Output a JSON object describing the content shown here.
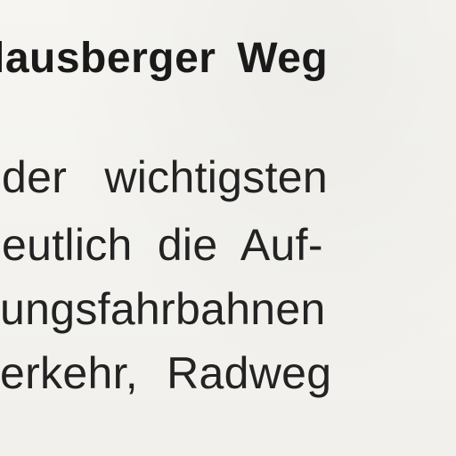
{
  "heading": "lausberger Weg",
  "lines": [
    "der wichtigsten",
    "eutlich die Auf-",
    "ungsfahrbahnen",
    "erkehr, Radweg"
  ]
}
